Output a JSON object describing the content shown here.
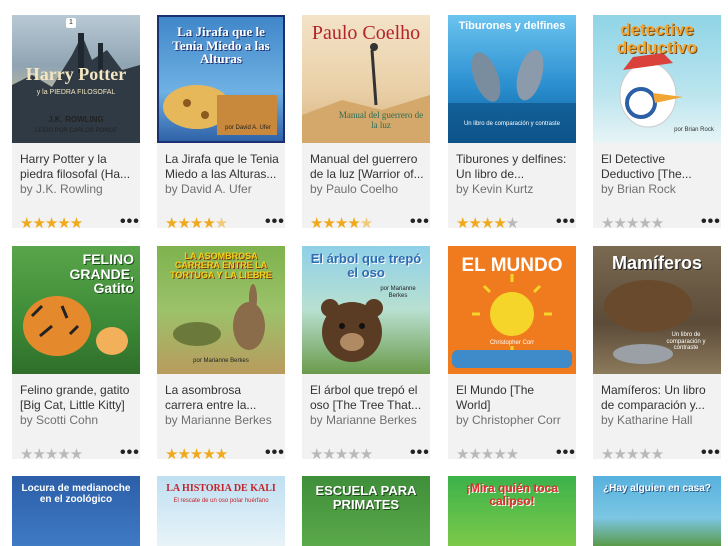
{
  "books": [
    {
      "title": "Harry Potter y la piedra filosofal (Ha...",
      "author": "by J.K. Rowling",
      "rating": 5,
      "cover_title": "Harry Potter",
      "cover_sub": "y la PIEDRA FILOSOFAL",
      "cover_author": "J.K. ROWLING",
      "cover_narr": "LEÍDO POR CARLOS PONCE",
      "cover_num": "1"
    },
    {
      "title": "La Jirafa que le Tenia Miedo a las Alturas...",
      "author": "by David A. Ufer",
      "rating": 4.5,
      "cover_title": "La Jirafa que le Tenia Miedo a las Alturas",
      "cover_sub": "por David A. Ufer"
    },
    {
      "title": "Manual del guerrero de la luz [Warrior of...",
      "author": "by Paulo Coelho",
      "rating": 4.5,
      "cover_title": "Paulo Coelho",
      "cover_sub": "Manual del guerrero de la luz"
    },
    {
      "title": "Tiburones y delfines: Un libro de...",
      "author": "by Kevin Kurtz",
      "rating": 4,
      "cover_title": "Tiburones y delfines",
      "cover_sub": "Un libro de comparación y contraste"
    },
    {
      "title": "El Detective Deductivo [The...",
      "author": "by Brian Rock",
      "rating": 0,
      "cover_title": "detective deductivo",
      "cover_sub": "por Brian Rock"
    },
    {
      "title": "Felino grande, gatito [Big Cat, Little Kitty]",
      "author": "by Scotti Cohn",
      "rating": 0,
      "cover_title": "FELINO GRANDE, Gatito",
      "cover_sub": ""
    },
    {
      "title": "La asombrosa carrera entre la...",
      "author": "by Marianne Berkes",
      "rating": 5,
      "cover_title": "LA ASOMBROSA CARRERA ENTRE LA TORTUGA Y LA LIEBRE",
      "cover_sub": "por Marianne Berkes"
    },
    {
      "title": "El árbol que trepó el oso [The Tree That...",
      "author": "by Marianne Berkes",
      "rating": 0,
      "cover_title": "El árbol que trepó el oso",
      "cover_sub": "por Marianne Berkes"
    },
    {
      "title": "El Mundo [The World]",
      "author": "by Christopher Corr",
      "rating": 0,
      "cover_title": "EL MUNDO",
      "cover_sub": "Christopher Corr"
    },
    {
      "title": "Mamíferos: Un libro de comparación y...",
      "author": "by Katharine Hall",
      "rating": 0,
      "cover_title": "Mamíferos",
      "cover_sub": "Un libro de comparación y contraste"
    },
    {
      "title": "",
      "author": "",
      "rating": 0,
      "cover_title": "Locura de medianoche en el zoológico",
      "cover_sub": ""
    },
    {
      "title": "",
      "author": "",
      "rating": 0,
      "cover_title": "LA HISTORIA DE KALI",
      "cover_sub": "El rescate de un oso polar huérfano"
    },
    {
      "title": "",
      "author": "",
      "rating": 0,
      "cover_title": "ESCUELA PARA PRIMATES",
      "cover_sub": ""
    },
    {
      "title": "",
      "author": "",
      "rating": 0,
      "cover_title": "¡Mira quién toca calipso!",
      "cover_sub": ""
    },
    {
      "title": "",
      "author": "",
      "rating": 0,
      "cover_title": "¿Hay alguien en casa?",
      "cover_sub": ""
    }
  ],
  "more_label": "•••",
  "colors": {
    "star_on": "#f0a91b",
    "star_off": "#b9b9b9",
    "card_bg": "#f2f2f2"
  },
  "icons": {
    "more": "more-options-icon",
    "star": "star-icon"
  }
}
